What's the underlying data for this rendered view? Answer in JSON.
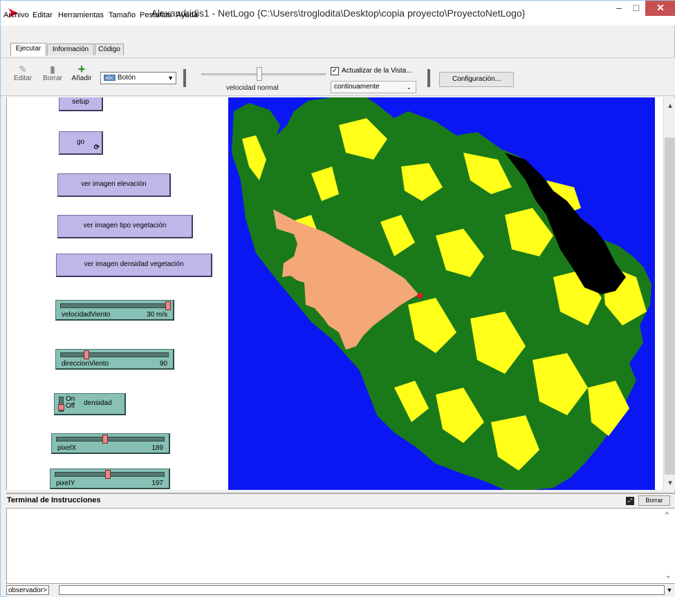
{
  "window": {
    "title": "Alexandridis1 - NetLogo {C:\\Users\\troglodita\\Desktop\\copia proyecto\\ProyectoNetLogo}",
    "controls": {
      "minimize": "–",
      "maximize": "□",
      "close": "✕"
    }
  },
  "menubar": [
    "Archivo",
    "Editar",
    "Herramientas",
    "Tamaño",
    "Pestañas",
    "Ayuda"
  ],
  "tabs": [
    {
      "label": "Ejecutar",
      "active": true
    },
    {
      "label": "Información",
      "active": false
    },
    {
      "label": "Código",
      "active": false
    }
  ],
  "toolbar": {
    "edit_label": "Editar",
    "delete_label": "Borrar",
    "add_label": "Añadir",
    "widget_type_icon": "abc",
    "widget_type": "Botón",
    "speed_label": "velocidad normal",
    "speed_fraction": 0.5,
    "update_checked": true,
    "update_label": "Actualizar de la Vista...",
    "update_mode": "continuamente",
    "config_label": "Configuración..."
  },
  "interface": {
    "buttons": {
      "setup": "setup",
      "go": "go",
      "go_forever_icon": "⟳",
      "elevation": "ver imagen elevación",
      "vegetation_type": "ver imagen tipo vegetación",
      "vegetation_density": "ver imagen densidad vegetación"
    },
    "sliders": {
      "wind_speed": {
        "name": "velocidadViento",
        "value": "30 m/s",
        "fraction": 0.98
      },
      "wind_direction": {
        "name": "direccionViento",
        "value": "90",
        "fraction": 0.25
      },
      "pixel_x": {
        "name": "pixelX",
        "value": "189",
        "fraction": 0.45
      },
      "pixel_y": {
        "name": "pixelY",
        "value": "197",
        "fraction": 0.48
      }
    },
    "switch": {
      "label": "densidad",
      "on": "On",
      "off": "Off",
      "state": "off"
    }
  },
  "world": {
    "colors": {
      "water": "#0b17f2",
      "dense_forest": "#1a7a1a",
      "sparse_vegetation": "#ffff1a",
      "burned": "#f4a878",
      "unburnable": "#000000",
      "fire_front": "#e8102a"
    }
  },
  "terminal": {
    "title": "Terminal de Instrucciones",
    "clear_label": "Borrar",
    "observer_prompt": "observador>",
    "command_value": ""
  },
  "colors": {
    "button_face": "#bdb8e8",
    "slider_face": "#87c0b4",
    "title_accent": "#e8102a"
  }
}
